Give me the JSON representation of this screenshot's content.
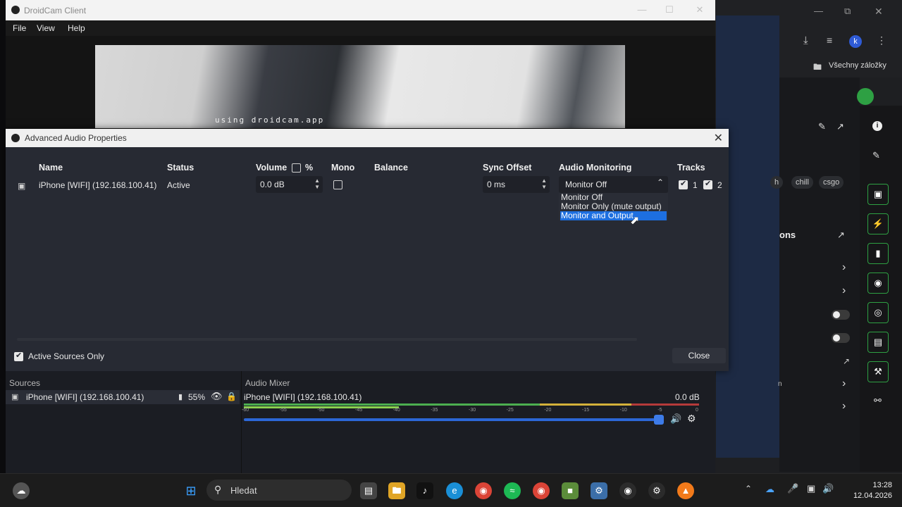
{
  "droidcam": {
    "title": "DroidCam Client",
    "menu": [
      "File",
      "View",
      "Help"
    ],
    "watermark": "using droidcam.app"
  },
  "browser": {
    "bookmarks_label": "Všechny záložky",
    "profile_initial": "k",
    "tags": [
      "h",
      "chill",
      "csgo"
    ],
    "section_partial": "ons",
    "partial_n": "n"
  },
  "dialog": {
    "title": "Advanced Audio Properties",
    "headers": {
      "name": "Name",
      "status": "Status",
      "volume": "Volume",
      "percent": "%",
      "mono": "Mono",
      "balance": "Balance",
      "sync": "Sync Offset",
      "monitoring": "Audio Monitoring",
      "tracks": "Tracks"
    },
    "row": {
      "name": "iPhone [WIFI] (192.168.100.41)",
      "status": "Active",
      "volume": "0.0 dB",
      "sync": "0 ms",
      "monitoring": "Monitor Off",
      "track1": "1",
      "track2": "2"
    },
    "monitoring_options": [
      "Monitor Off",
      "Monitor Only (mute output)",
      "Monitor and Output"
    ],
    "selected_option_index": 2,
    "active_sources_only": "Active Sources Only",
    "close": "Close"
  },
  "docks": {
    "sources_title": "Sources",
    "source_name": "iPhone [WIFI] (192.168.100.41)",
    "source_percent": "55%",
    "mixer_title": "Audio Mixer",
    "mixer_source": "iPhone [WIFI] (192.168.100.41)",
    "mixer_db": "0.0 dB",
    "ticks": [
      "-60",
      "-55",
      "-50",
      "-45",
      "-40",
      "-35",
      "-30",
      "-25",
      "-20",
      "-15",
      "-10",
      "-5",
      "0"
    ],
    "volume_fraction": 1.0
  },
  "taskbar": {
    "search_placeholder": "Hledat",
    "time": "13:28",
    "date": "12.04.2026"
  },
  "colors": {
    "accent": "#1d6fe0",
    "green_border": "#2ea043"
  }
}
